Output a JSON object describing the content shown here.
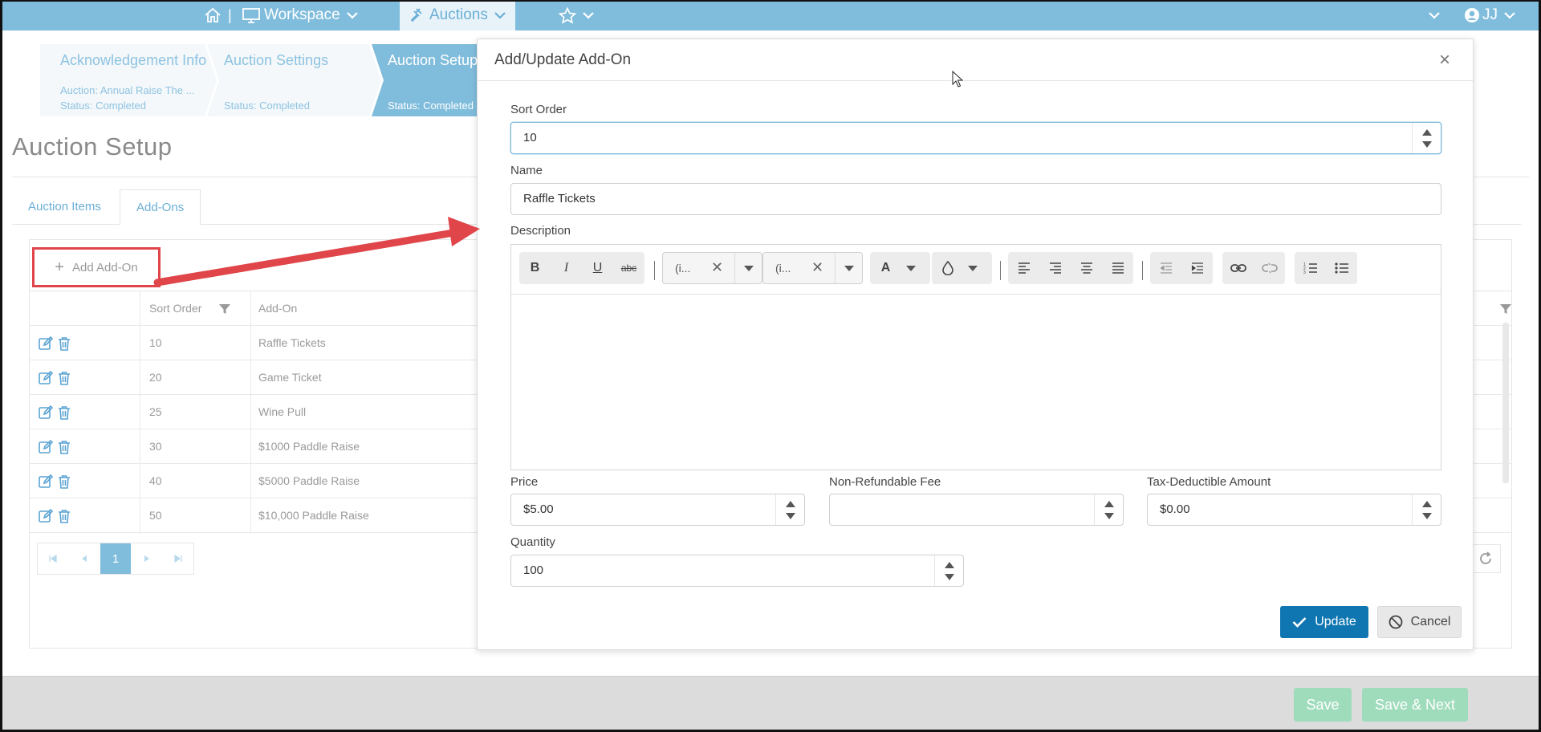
{
  "nav": {
    "workspace_label": "Workspace",
    "auctions_label": "Auctions",
    "user_initials": "JJ",
    "separator": "|"
  },
  "wizard": {
    "steps": [
      {
        "title": "Acknowledgement Info",
        "line1": "Auction: Annual Raise The ...",
        "line2": "Status: Completed"
      },
      {
        "title": "Auction Settings",
        "line1": "",
        "line2": "Status: Completed"
      },
      {
        "title": "Auction Setup",
        "line1": "",
        "line2": "Status: Completed"
      }
    ]
  },
  "page": {
    "title": "Auction Setup"
  },
  "tabs": [
    {
      "label": "Auction Items"
    },
    {
      "label": "Add-Ons"
    }
  ],
  "grid": {
    "add_button": "Add Add-On",
    "columns": {
      "sort_order": "Sort Order",
      "add_on": "Add-On"
    },
    "rows": [
      {
        "sort": "10",
        "name": "Raffle Tickets"
      },
      {
        "sort": "20",
        "name": "Game Ticket"
      },
      {
        "sort": "25",
        "name": "Wine Pull"
      },
      {
        "sort": "30",
        "name": "$1000 Paddle Raise"
      },
      {
        "sort": "40",
        "name": "$5000 Paddle Raise"
      },
      {
        "sort": "50",
        "name": "$10,000 Paddle Raise"
      }
    ],
    "current_page": "1"
  },
  "footer": {
    "save": "Save",
    "save_next": "Save & Next"
  },
  "modal": {
    "title": "Add/Update Add-On",
    "close": "×",
    "sort_order_label": "Sort Order",
    "sort_order_value": "10",
    "name_label": "Name",
    "name_value": "Raffle Tickets",
    "description_label": "Description",
    "font_combo": "(i...",
    "size_combo": "(i...",
    "price_label": "Price",
    "price_value": "$5.00",
    "fee_label": "Non-Refundable Fee",
    "fee_value": "",
    "tax_label": "Tax-Deductible Amount",
    "tax_value": "$0.00",
    "quantity_label": "Quantity",
    "quantity_value": "100",
    "update_button": "Update",
    "cancel_button": "Cancel"
  },
  "colors": {
    "nav": "#80bddc",
    "update": "#0f76b2",
    "annotation_red": "#e0454a",
    "save_green": "#9fdcbc"
  }
}
